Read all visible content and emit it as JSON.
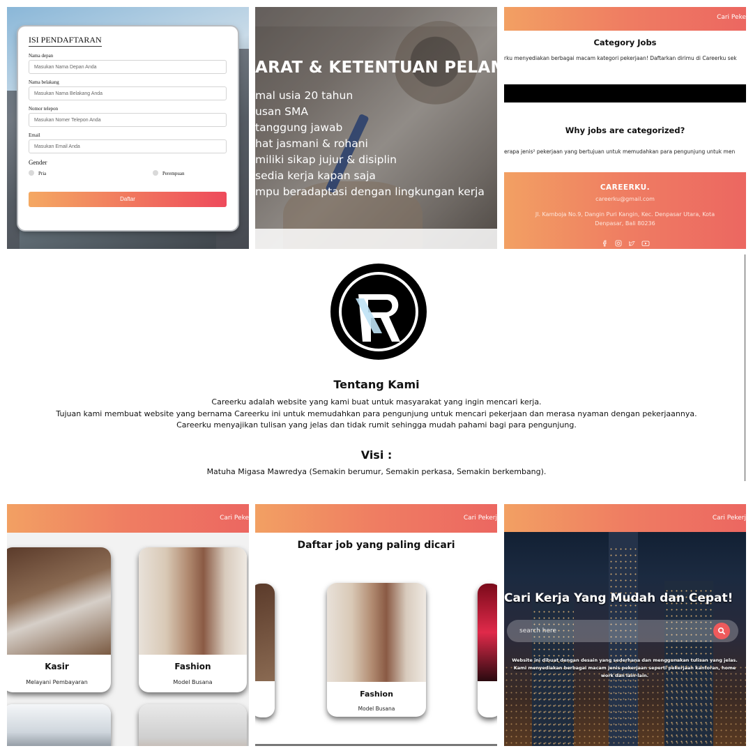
{
  "registration": {
    "title": "ISI PENDAFTARAN",
    "fields": [
      {
        "label": "Nama depan",
        "placeholder": "Masukan Nama Depan Anda"
      },
      {
        "label": "Nama belakang",
        "placeholder": "Masukan Nama Belakang Anda"
      },
      {
        "label": "Nomor telepon",
        "placeholder": "Masukan Nomer Telepon Anda"
      },
      {
        "label": "Email",
        "placeholder": "Masukan Email Anda"
      }
    ],
    "gender_label": "Gender",
    "gender_options": [
      "Pria",
      "Perempuan"
    ],
    "submit_label": "Daftar"
  },
  "requirements": {
    "heading": "ARAT & KETENTUAN PELAM",
    "items": [
      "mal usia 20 tahun",
      "usan SMA",
      "tanggung jawab",
      "hat jasmani & rohani",
      "miliki sikap jujur & disiplin",
      "sedia kerja kapan saja",
      "mpu beradaptasi dengan lingkungan kerja"
    ]
  },
  "category_page": {
    "nav_label": "Cari Peke",
    "title1": "Category Jobs",
    "text1": "rku menyediakan berbagai macam kategori pekerjaan! Daftarkan dirimu di Careerku sek",
    "title2": "Why jobs are categorized?",
    "text2": "erapa jenis² pekerjaan yang bertujuan untuk memudahkan para pengunjung untuk men",
    "footer": {
      "brand": "CAREERKU.",
      "email": "careerku@gmail.com",
      "address": "Jl. Kamboja No.9, Dangin Puri Kangin, Kec. Denpasar Utara, Kota Denpasar, Bali 80236",
      "social_icons": [
        "facebook-icon",
        "instagram-icon",
        "twitter-icon",
        "youtube-icon"
      ]
    }
  },
  "about": {
    "title": "Tentang Kami",
    "lines": [
      "Careerku adalah website yang kami buat untuk masyarakat yang ingin mencari kerja.",
      "Tujuan kami membuat website yang bernama Careerku ini untuk memudahkan para pengunjung untuk mencari pekerjaan dan merasa nyaman dengan pekerjaannya.",
      "Careerku menyajikan tulisan yang jelas dan tidak rumit sehingga mudah pahami bagi para pengunjung."
    ],
    "visi_title": "Visi :",
    "visi_text": "Matuha Migasa Mawredya (Semakin berumur, Semakin perkasa, Semakin berkembang)."
  },
  "jobs_grid": {
    "nav_label": "Cari Peke",
    "cards": [
      {
        "title": "Kasir",
        "subtitle": "Melayani Pembayaran"
      },
      {
        "title": "Fashion",
        "subtitle": "Model Busana"
      }
    ]
  },
  "popular": {
    "nav_label": "Cari Pekerj",
    "title": "Daftar job yang paling dicari",
    "card": {
      "title": "Fashion",
      "subtitle": "Model Busana"
    }
  },
  "hero": {
    "nav_label": "Cari Pekerj",
    "title": "Cari Kerja Yang Mudah dan Cepat!",
    "search_placeholder": "search here",
    "description": "Website ini dibuat dengan desain yang sederhana dan menggunakan tulisan yang jelas. Kami menyediakan berbagai macam jenis pekerjaan seperti pekerjaan kantoran, home work dan lain-lain."
  },
  "colors": {
    "accent_start": "#f2a063",
    "accent_end": "#ec6761"
  }
}
